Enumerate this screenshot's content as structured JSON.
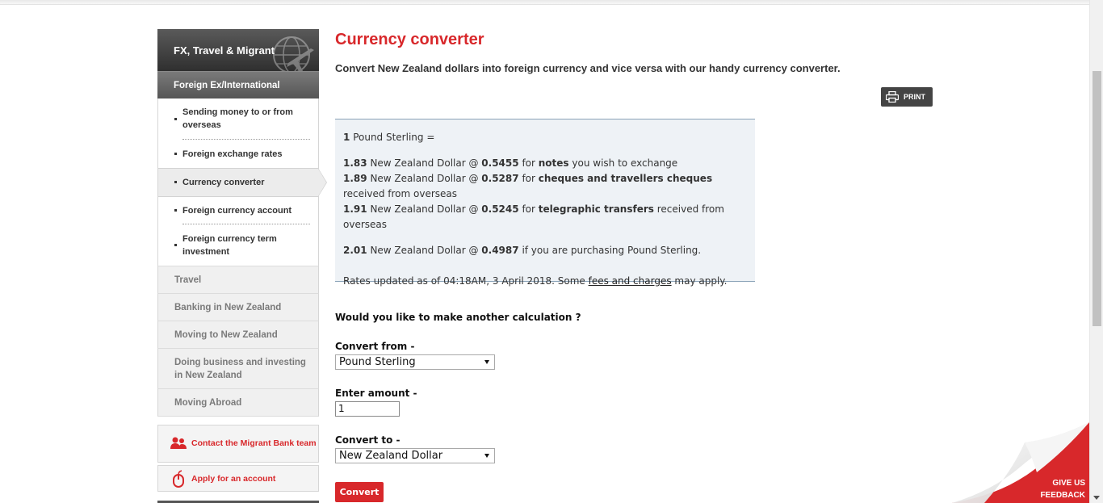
{
  "sidebar": {
    "header": "FX, Travel & Migrant",
    "subheader": "Foreign Ex/International",
    "items": [
      {
        "label": "Sending money to or from overseas"
      },
      {
        "label": "Foreign exchange rates"
      },
      {
        "label": "Currency converter"
      },
      {
        "label": "Foreign currency account"
      },
      {
        "label": "Foreign currency term investment"
      }
    ],
    "categories": [
      {
        "label": "Travel"
      },
      {
        "label": "Banking in New Zealand"
      },
      {
        "label": "Moving to New Zealand"
      },
      {
        "label": "Doing business and investing in New Zealand"
      },
      {
        "label": "Moving Abroad"
      }
    ],
    "actions": [
      {
        "label": "Contact the Migrant Bank team",
        "icon": "people-icon"
      },
      {
        "label": "Apply for an account",
        "icon": "mouse-icon"
      }
    ]
  },
  "main": {
    "title": "Currency converter",
    "intro": "Convert New Zealand dollars into foreign currency and vice versa with our handy currency converter.",
    "print_label": "PRINT",
    "result": {
      "base_amount": "1",
      "base_currency": "Pound Sterling =",
      "rows": [
        {
          "amount": "1.83",
          "currency": "New Zealand Dollar @",
          "rate": "0.5455",
          "pre": "for",
          "type": "notes",
          "post": "you wish to exchange"
        },
        {
          "amount": "1.89",
          "currency": "New Zealand Dollar @",
          "rate": "0.5287",
          "pre": "for",
          "type": "cheques and travellers cheques",
          "post": "received from overseas"
        },
        {
          "amount": "1.91",
          "currency": "New Zealand Dollar @",
          "rate": "0.5245",
          "pre": "for",
          "type": "telegraphic transfers",
          "post": "received from overseas"
        }
      ],
      "purchase": {
        "amount": "2.01",
        "currency": "New Zealand Dollar @",
        "rate": "0.4987",
        "post": "if you are purchasing Pound Sterling."
      },
      "updated_prefix": "Rates updated as of 04:18AM, 3 April 2018. Some",
      "fees_link": "fees and charges",
      "updated_suffix": "may apply."
    },
    "form": {
      "question": "Would you like to make another calculation ?",
      "from_label": "Convert from -",
      "from_value": "Pound Sterling",
      "amount_label": "Enter amount -",
      "amount_value": "1",
      "to_label": "Convert to -",
      "to_value": "New Zealand Dollar",
      "convert_label": "Convert"
    }
  },
  "feedback": {
    "line1": "GIVE US",
    "line2": "FEEDBACK"
  },
  "colors": {
    "brand_red": "#d8282b",
    "dark_grey": "#444444",
    "box_bg": "#eef2f6"
  }
}
